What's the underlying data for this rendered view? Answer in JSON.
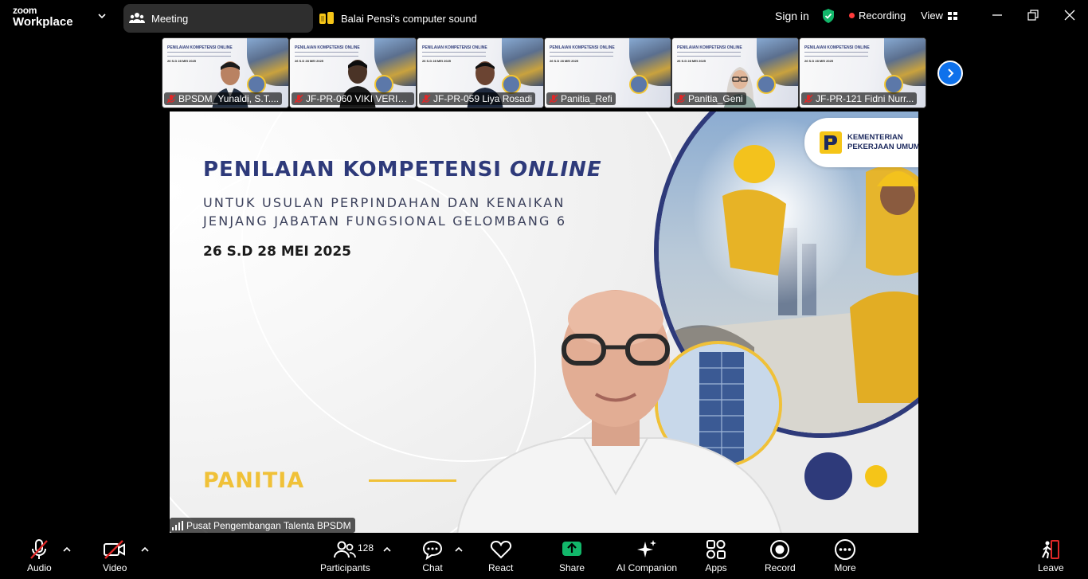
{
  "titlebar": {
    "brand_top": "zoom",
    "brand_bottom": "Workplace",
    "tab_meeting": "Meeting",
    "tab_sound": "Balai Pensi's computer sound",
    "signin": "Sign in",
    "recording": "Recording",
    "view": "View"
  },
  "thumbnails": [
    {
      "name": "BPSDM_Yunaldi, S.T...."
    },
    {
      "name": "JF-PR-060 VIKI VERIA..."
    },
    {
      "name": "JF-PR-059 Liya Rosadi"
    },
    {
      "name": "Panitia_Refi"
    },
    {
      "name": "Panitia_Geni"
    },
    {
      "name": "JF-PR-121 Fidni Nurr..."
    }
  ],
  "slide": {
    "title_main": "PENILAIAN KOMPETENSI ",
    "title_italic": "ONLINE",
    "subtitle_line1": "UNTUK USULAN PERPINDAHAN DAN KENAIKAN",
    "subtitle_line2": "JENJANG JABATAN FUNGSIONAL GELOMBANG 6",
    "date": "26 S.D 28 MEI 2025",
    "footer": "PANITIA",
    "logo_line1": "KEMENTERIAN",
    "logo_line2": "PEKERJAAN UMUM"
  },
  "stage": {
    "speaker_name": "Pusat Pengembangan Talenta BPSDM"
  },
  "toolbar": {
    "audio": "Audio",
    "video": "Video",
    "participants": "Participants",
    "participant_count": "128",
    "chat": "Chat",
    "react": "React",
    "share": "Share",
    "ai_companion": "AI Companion",
    "apps": "Apps",
    "record": "Record",
    "more": "More",
    "leave": "Leave"
  },
  "colors": {
    "accent_blue": "#0e71eb",
    "share_green": "#12b76a",
    "muted_red": "#e02828",
    "slide_navy": "#2e3a7a",
    "slide_gold": "#f0c138"
  }
}
